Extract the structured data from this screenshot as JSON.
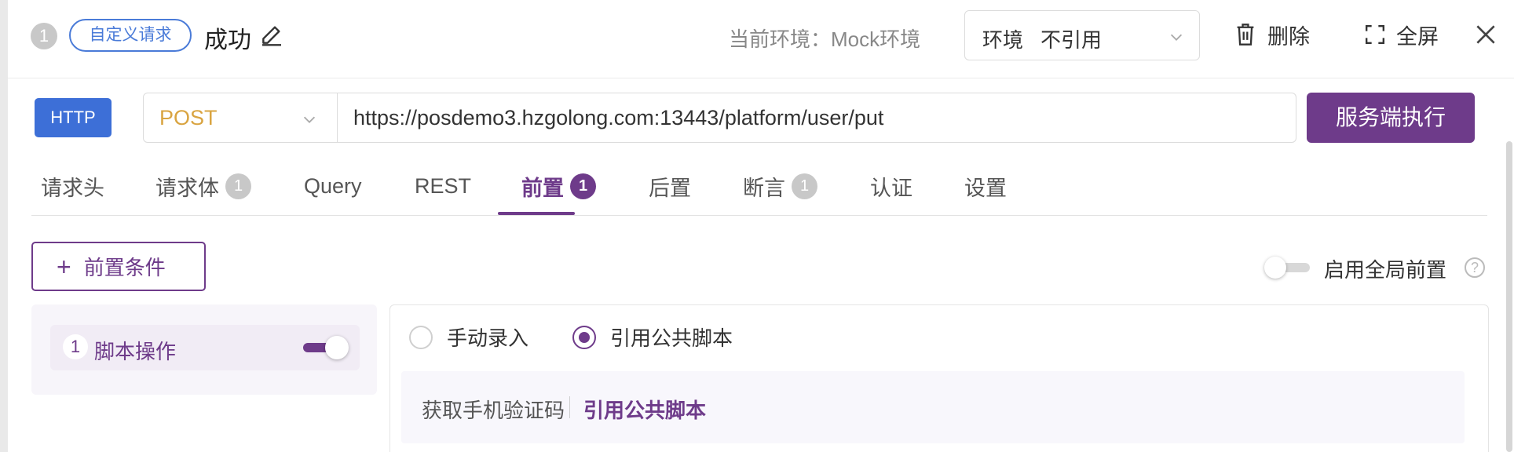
{
  "header": {
    "step_number": "1",
    "tag": "自定义请求",
    "title": "成功",
    "current_env_label": "当前环境：Mock环境",
    "env_select": {
      "key": "环境",
      "value": "不引用"
    },
    "delete_label": "删除",
    "fullscreen_label": "全屏"
  },
  "request": {
    "protocol": "HTTP",
    "method": "POST",
    "url": "https://posdemo3.hzgolong.com:13443/platform/user/put",
    "execute_label": "服务端执行"
  },
  "tabs": [
    {
      "label": "请求头",
      "badge": ""
    },
    {
      "label": "请求体",
      "badge": "1"
    },
    {
      "label": "Query",
      "badge": ""
    },
    {
      "label": "REST",
      "badge": ""
    },
    {
      "label": "前置",
      "badge": "1"
    },
    {
      "label": "后置",
      "badge": ""
    },
    {
      "label": "断言",
      "badge": "1"
    },
    {
      "label": "认证",
      "badge": ""
    },
    {
      "label": "设置",
      "badge": ""
    }
  ],
  "active_tab": "前置",
  "pre": {
    "add_label": "前置条件",
    "global_label": "启用全局前置",
    "global_enabled": false,
    "help_glyph": "?",
    "scripts": [
      {
        "number": "1",
        "label": "脚本操作",
        "enabled": true
      }
    ],
    "radio_manual": "手动录入",
    "radio_public": "引用公共脚本",
    "selected_mode": "引用公共脚本",
    "ref_name": "获取手机验证码",
    "ref_link": "引用公共脚本"
  },
  "colors": {
    "accent": "#6e3b8a",
    "http_badge": "#3d6fd7",
    "method": "#d9a441"
  }
}
